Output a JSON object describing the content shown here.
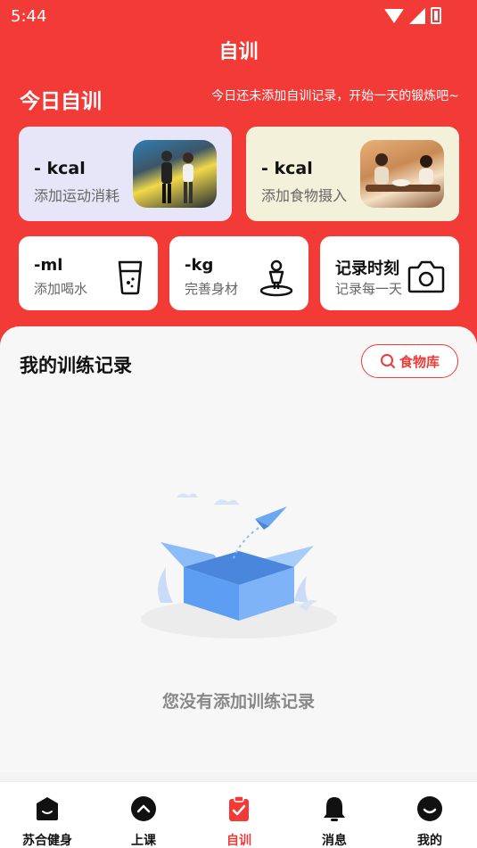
{
  "status": {
    "time": "5:44"
  },
  "header": {
    "title": "自训"
  },
  "today": {
    "title": "今日自训",
    "subtitle": "今日还未添加自训记录，开始一天的锻炼吧~"
  },
  "cards": {
    "exercise": {
      "value": "- kcal",
      "label": "添加运动消耗"
    },
    "food": {
      "value": "- kcal",
      "label": "添加食物摄入"
    },
    "water": {
      "value": "-ml",
      "label": "添加喝水"
    },
    "body": {
      "value": "-kg",
      "label": "完善身材"
    },
    "moment": {
      "value": "记录时刻",
      "label": "记录每一天"
    }
  },
  "records": {
    "title": "我的训练记录",
    "food_library_label": "食物库",
    "empty_text": "您没有添加训练记录"
  },
  "tabs": [
    {
      "label": "苏合健身",
      "icon": "home-icon"
    },
    {
      "label": "上课",
      "icon": "class-icon"
    },
    {
      "label": "自训",
      "icon": "clipboard-check-icon",
      "active": true
    },
    {
      "label": "消息",
      "icon": "bell-icon"
    },
    {
      "label": "我的",
      "icon": "profile-icon"
    }
  ],
  "colors": {
    "accent": "#f23a37",
    "card_exercise_bg": "#e6e6f8",
    "card_food_bg": "#f3f1d9"
  }
}
